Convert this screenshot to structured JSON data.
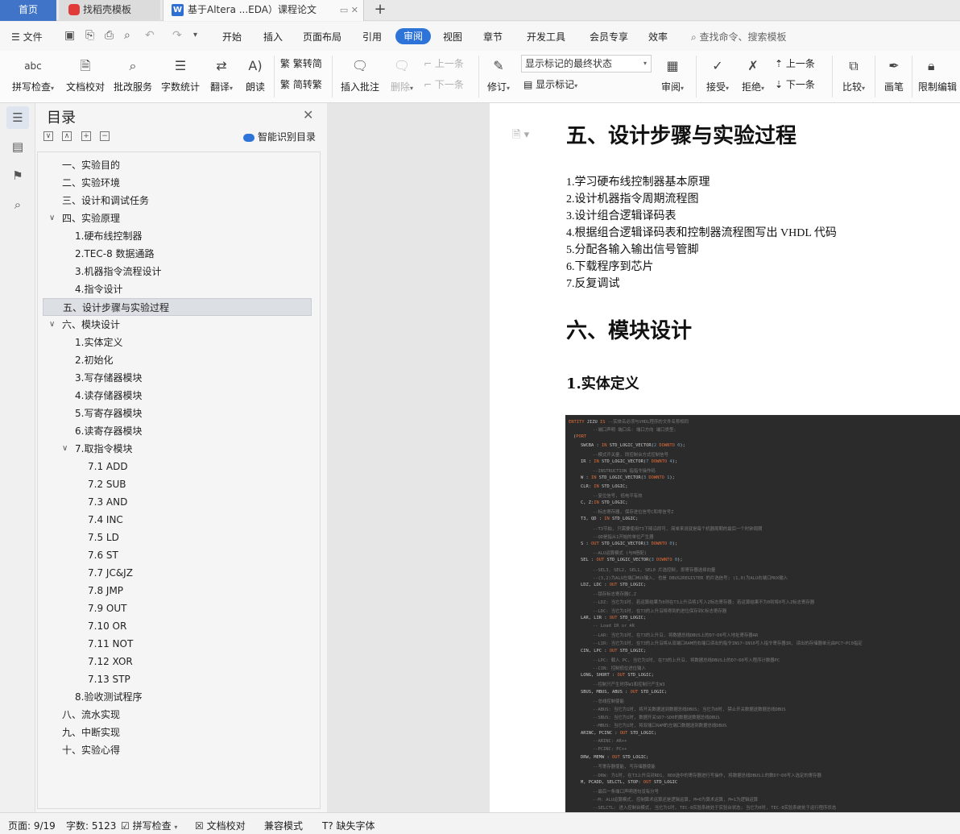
{
  "tabs": {
    "home": "首页",
    "template": "找稻壳模板",
    "document": "基于Altera ...EDA）课程论文",
    "new_tab": "+"
  },
  "menubar": {
    "file": "文件",
    "tabs": [
      "开始",
      "插入",
      "页面布局",
      "引用",
      "审阅",
      "视图",
      "章节",
      "开发工具",
      "会员专享",
      "效率"
    ],
    "active": "审阅",
    "search": "查找命令、搜索模板"
  },
  "ribbon": {
    "spellcheck": "拼写检查",
    "proofread": "文档校对",
    "batch": "批改服务",
    "wordcount": "字数统计",
    "translate": "翻译",
    "read_aloud": "朗读",
    "trad": "繁转简",
    "simp": "简转繁",
    "insert_comment": "插入批注",
    "delete": "删除",
    "prev_comment": "上一条",
    "next_comment": "下一条",
    "revise": "修订",
    "markup_select": "显示标记的最终状态",
    "show_markup": "显示标记",
    "review": "审阅",
    "accept": "接受",
    "reject": "拒绝",
    "prev_change": "上一条",
    "next_change": "下一条",
    "compare": "比较",
    "pen": "画笔",
    "restrict": "限制编辑"
  },
  "toc": {
    "title": "目录",
    "smart": "智能识别目录",
    "items": [
      {
        "label": "一、实验目的",
        "level": 1,
        "arrow": ""
      },
      {
        "label": "二、实验环境",
        "level": 1,
        "arrow": ""
      },
      {
        "label": "三、设计和调试任务",
        "level": 1,
        "arrow": ""
      },
      {
        "label": "四、实验原理",
        "level": 1,
        "arrow": "v"
      },
      {
        "label": "1.硬布线控制器",
        "level": 2,
        "arrow": ""
      },
      {
        "label": "2.TEC-8 数据通路",
        "level": 2,
        "arrow": ""
      },
      {
        "label": "3.机器指令流程设计",
        "level": 2,
        "arrow": ""
      },
      {
        "label": "4.指令设计",
        "level": 2,
        "arrow": ""
      },
      {
        "label": "五、设计步骤与实验过程",
        "level": 1,
        "arrow": "",
        "selected": true
      },
      {
        "label": "六、模块设计",
        "level": 1,
        "arrow": "v"
      },
      {
        "label": "1.实体定义",
        "level": 2,
        "arrow": ""
      },
      {
        "label": "2.初始化",
        "level": 2,
        "arrow": ""
      },
      {
        "label": "3.写存储器模块",
        "level": 2,
        "arrow": ""
      },
      {
        "label": "4.读存储器模块",
        "level": 2,
        "arrow": ""
      },
      {
        "label": "5.写寄存器模块",
        "level": 2,
        "arrow": ""
      },
      {
        "label": "6.读寄存器模块",
        "level": 2,
        "arrow": ""
      },
      {
        "label": "7.取指令模块",
        "level": 2,
        "arrow": "v"
      },
      {
        "label": "7.1 ADD",
        "level": 3,
        "arrow": ""
      },
      {
        "label": "7.2 SUB",
        "level": 3,
        "arrow": ""
      },
      {
        "label": "7.3 AND",
        "level": 3,
        "arrow": ""
      },
      {
        "label": "7.4 INC",
        "level": 3,
        "arrow": ""
      },
      {
        "label": "7.5 LD",
        "level": 3,
        "arrow": ""
      },
      {
        "label": "7.6 ST",
        "level": 3,
        "arrow": ""
      },
      {
        "label": "7.7 JC&JZ",
        "level": 3,
        "arrow": ""
      },
      {
        "label": "7.8 JMP",
        "level": 3,
        "arrow": ""
      },
      {
        "label": "7.9 OUT",
        "level": 3,
        "arrow": ""
      },
      {
        "label": "7.10 OR",
        "level": 3,
        "arrow": ""
      },
      {
        "label": "7.11 NOT",
        "level": 3,
        "arrow": ""
      },
      {
        "label": "7.12 XOR",
        "level": 3,
        "arrow": ""
      },
      {
        "label": "7.13 STP",
        "level": 3,
        "arrow": ""
      },
      {
        "label": "8.验收测试程序",
        "level": 2,
        "arrow": ""
      },
      {
        "label": "八、流水实现",
        "level": 1,
        "arrow": ""
      },
      {
        "label": "九、中断实现",
        "level": 1,
        "arrow": ""
      },
      {
        "label": "十、实验心得",
        "level": 1,
        "arrow": ""
      }
    ]
  },
  "document": {
    "heading_five": "五、设计步骤与实验过程",
    "steps": [
      "1.学习硬布线控制器基本原理",
      "2.设计机器指令周期流程图",
      "3.设计组合逻辑译码表",
      "4.根据组合逻辑译码表和控制器流程图写出 VHDL 代码",
      "5.分配各输入输出信号管脚",
      "6.下载程序到芯片",
      "7.反复调试"
    ],
    "heading_six": "六、模块设计",
    "heading_entity": "1.实体定义",
    "code_lines": [
      {
        "i": 0,
        "k": "ENTITY",
        "t": " JIZU ",
        "k2": "IS",
        "c": "  --实体名必须与VHDL程序的文件名称相同"
      },
      {
        "i": 10,
        "c": "--端口声明 端口名: 端口方向 端口类型;"
      },
      {
        "i": 2,
        "k": "PORT",
        "t": "("
      },
      {
        "i": 5,
        "t": "SWCBA : ",
        "k": "IN",
        "t2": " STD_LOGIC_VECTOR(",
        "n": "2",
        "k2": " DOWNTO ",
        "n2": "0",
        "t3": ");"
      },
      {
        "i": 10,
        "c": "--模式开关量, 即控制台方式控制信号"
      },
      {
        "i": 5,
        "t": "IR : ",
        "k": "IN",
        "t2": " STD_LOGIC_VECTOR(",
        "n": "7",
        "k2": " DOWNTO ",
        "n2": "4",
        "t3": ");"
      },
      {
        "i": 10,
        "c": "--INSTRUCTION 指指令操作码"
      },
      {
        "i": 5,
        "t": "W : ",
        "k": "IN",
        "t2": " STD_LOGIC_VECTOR(",
        "n": "3",
        "k2": " DOWNTO ",
        "n2": "1",
        "t3": ");"
      },
      {
        "i": 5,
        "t": "CLR: ",
        "k": "IN",
        "t2": " STD_LOGIC;"
      },
      {
        "i": 10,
        "c": "--复位信号, 低电平有效"
      },
      {
        "i": 5,
        "t": "C, Z:",
        "k": "IN",
        "t2": " STD_LOGIC;"
      },
      {
        "i": 10,
        "c": "--标志寄存器, 保存进位信号C和零信号Z"
      },
      {
        "i": 5,
        "t": "T3, QD : ",
        "k": "IN",
        "t2": " STD_LOGIC;"
      },
      {
        "i": 10,
        "c": "--T3节拍, 只需要使用T3下降沿即可, 简单来说就是每个机器周期的最后一个时钟周期"
      },
      {
        "i": 10,
        "c": "--QD是指从1开始的单位产生器"
      },
      {
        "i": 5,
        "t": "S : ",
        "k": "OUT",
        "t2": " STD_LOGIC_VECTOR(",
        "n": "3",
        "k2": " DOWNTO ",
        "n2": "0",
        "t3": ");"
      },
      {
        "i": 10,
        "c": "--ALU运算模式 (与M搭配)"
      },
      {
        "i": 5,
        "t": "SEL : ",
        "k": "OUT",
        "t2": " STD_LOGIC_VECTOR(",
        "n": "3",
        "k2": " DOWNTO ",
        "n2": "0",
        "t3": ");"
      },
      {
        "i": 10,
        "c": "--SEL3, SEL2, SEL1, SEL0 片选控制, 即寄存器选择向量"
      },
      {
        "i": 10,
        "c": "--(3,2)为ALU左端口MUX输入, 也是 DBUS2REGISTER 的片选信号; (1,0)为ALU右端口MUX输入"
      },
      {
        "i": 5,
        "t": "LDZ, LDC : ",
        "k": "OUT",
        "t2": " STD_LOGIC;"
      },
      {
        "i": 10,
        "c": "--锁存标志寄存器C,Z"
      },
      {
        "i": 10,
        "c": "--LDZ: 当它为1时, 若运算结果为0则在T3上升沿将1写入Z标志寄存器; 若运算结果不为0则将0写入Z标志寄存器"
      },
      {
        "i": 10,
        "c": "--LDC: 当它为1时, 在T3的上升沿将得到的进位保存到C标志寄存器"
      },
      {
        "i": 5,
        "t": "LAR, LIR : ",
        "k": "OUT",
        "t2": " STD_LOGIC;"
      },
      {
        "i": 10,
        "c": "-- Load IR or AR"
      },
      {
        "i": 10,
        "c": "--LAR: 当它为1时, 在T3的上升沿, 将数据总线DBUS上的D7~D0写入地址寄存器AR"
      },
      {
        "i": 10,
        "c": "--LIR: 当它为1时, 在T3的上升沿将从双端口RAM的右端口读出的指令INS7~INS0写入指令寄存器IR, 读出的存储器单元由PC7~PC0指定"
      },
      {
        "i": 5,
        "t": "CIN, LPC : ",
        "k": "OUT",
        "t2": " STD_LOGIC;"
      },
      {
        "i": 10,
        "c": "--LPC: 载入 PC, 当它为1时, 在T3的上升沿, 将数据总线DBUS上的D7~D0写入程序计数器PC"
      },
      {
        "i": 10,
        "c": "--CIN: 控制低位进位输入"
      },
      {
        "i": 5,
        "t": "LONG, SHORT : ",
        "k": "OUT",
        "t2": " STD_LOGIC;"
      },
      {
        "i": 10,
        "c": "--控制只产生时序W1和控制只产生W3"
      },
      {
        "i": 5,
        "t": "SBUS, MBUS, ABUS : ",
        "k": "OUT",
        "t2": " STD_LOGIC;"
      },
      {
        "i": 10,
        "c": "--总线控制使能"
      },
      {
        "i": 10,
        "c": "--ABUS: 当它为1时, 将开关数据送到数据总线DBUS; 当它为0时, 禁止开关数据送数据总线DBUS"
      },
      {
        "i": 10,
        "c": "--SBUS: 当它为1时, 数据开关SD7~SD0的数据送数据总线DBUS"
      },
      {
        "i": 10,
        "c": "--MBUS: 当它为1时, 将双端口RAM的左端口数据送到数据总线DBUS"
      },
      {
        "i": 5,
        "t": "ARINC, PCINC : ",
        "k": "OUT",
        "t2": " STD_LOGIC;"
      },
      {
        "i": 10,
        "c": "--ARINC: AR++"
      },
      {
        "i": 10,
        "c": "--PCINC: PC++"
      },
      {
        "i": 5,
        "t": "DRW, MEMW : ",
        "k": "OUT",
        "t2": " STD_LOGIC;"
      },
      {
        "i": 10,
        "c": "--写寄存器使能, 写存储器使能"
      },
      {
        "i": 10,
        "c": "--DRW: 为1时, 在T3上升沿对RD1, RD0选中的寄存器进行写操作, 将数据总线DBUS上的数D7~D0写入选定的寄存器"
      },
      {
        "i": 5,
        "t": "M, PCADD, SELCTL, STOP: ",
        "k": "OUT",
        "t2": " STD_LOGIC"
      },
      {
        "i": 10,
        "c": "--最后一条端口声明语句没有分号"
      },
      {
        "i": 10,
        "c": "--M: ALU运算模式, 控制算术运算还是逻辑运算, M=0为算术运算, M=1为逻辑运算"
      },
      {
        "i": 10,
        "c": "--SELCTL: 进入控制台模式, 当它为1时, TEC-8实验系统处于实验台状态; 当它为0时, TEC-8实验系统处于运行程序状态"
      }
    ]
  },
  "status": {
    "page": "页面: 9/19",
    "words": "字数: 5123",
    "spell": "拼写检查",
    "proof": "文档校对",
    "compat": "兼容模式",
    "font": "缺失字体"
  }
}
